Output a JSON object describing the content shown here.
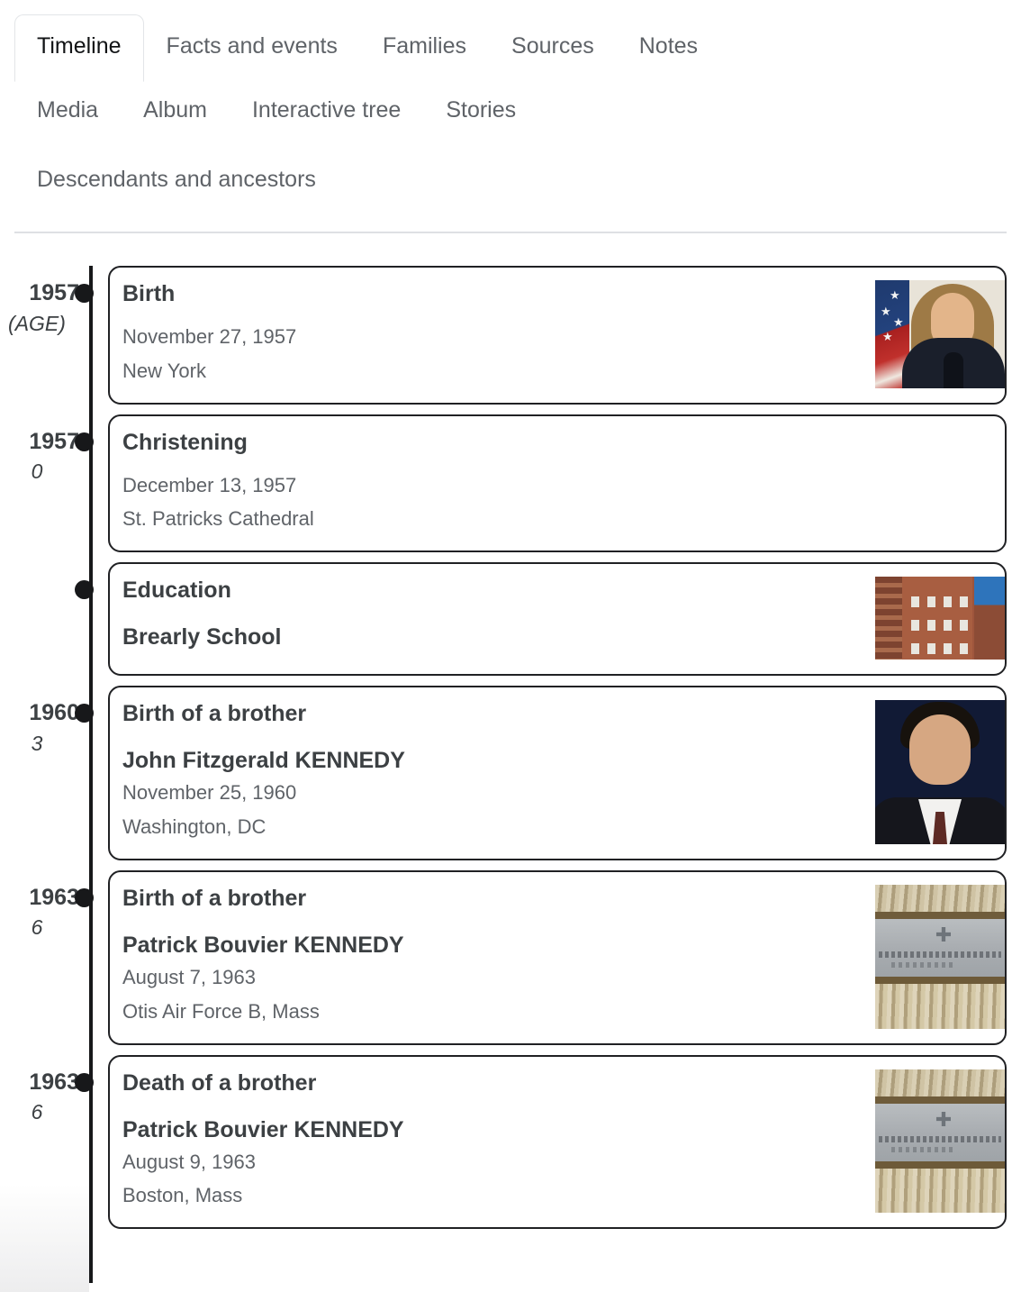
{
  "tabs": {
    "rows": [
      [
        {
          "label": "Timeline",
          "active": true
        },
        {
          "label": "Facts and events",
          "active": false
        },
        {
          "label": "Families",
          "active": false
        },
        {
          "label": "Sources",
          "active": false
        },
        {
          "label": "Notes",
          "active": false
        }
      ],
      [
        {
          "label": "Media",
          "active": false
        },
        {
          "label": "Album",
          "active": false
        },
        {
          "label": "Interactive tree",
          "active": false
        },
        {
          "label": "Stories",
          "active": false
        }
      ],
      [
        {
          "label": "Descendants and ancestors",
          "active": false
        }
      ]
    ]
  },
  "timeline": {
    "entries": [
      {
        "year": "1957",
        "age": "(AGE)",
        "title": "Birth",
        "subject": "",
        "date": "November 27, 1957",
        "place": "New York",
        "image": "portrait-caroline-kennedy"
      },
      {
        "year": "1957",
        "age": "0",
        "title": "Christening",
        "subject": "",
        "date": "December 13, 1957",
        "place": "St. Patricks Cathedral",
        "image": ""
      },
      {
        "year": "",
        "age": "",
        "title": "Education",
        "subject": "Brearly School",
        "date": "",
        "place": "",
        "image": "photo-brearly-school-building"
      },
      {
        "year": "1960",
        "age": "3",
        "title": "Birth of a brother",
        "subject": "John Fitzgerald KENNEDY",
        "date": "November 25, 1960",
        "place": "Washington, DC",
        "image": "portrait-john-f-kennedy-jr"
      },
      {
        "year": "1963",
        "age": "6",
        "title": "Birth of a brother",
        "subject": "Patrick Bouvier KENNEDY",
        "date": "August 7, 1963",
        "place": "Otis Air Force B, Mass",
        "image": "photo-grave-marker"
      },
      {
        "year": "1963",
        "age": "6",
        "title": "Death of a brother",
        "subject": "Patrick Bouvier KENNEDY",
        "date": "August 9, 1963",
        "place": "Boston, Mass",
        "image": "photo-grave-marker"
      }
    ]
  },
  "colors": {
    "axis": "#17181a",
    "card_border": "#202124",
    "text_primary": "#3c4043",
    "text_secondary": "#5f6368",
    "tab_active_text": "#111315",
    "divider": "#dee0e4"
  }
}
